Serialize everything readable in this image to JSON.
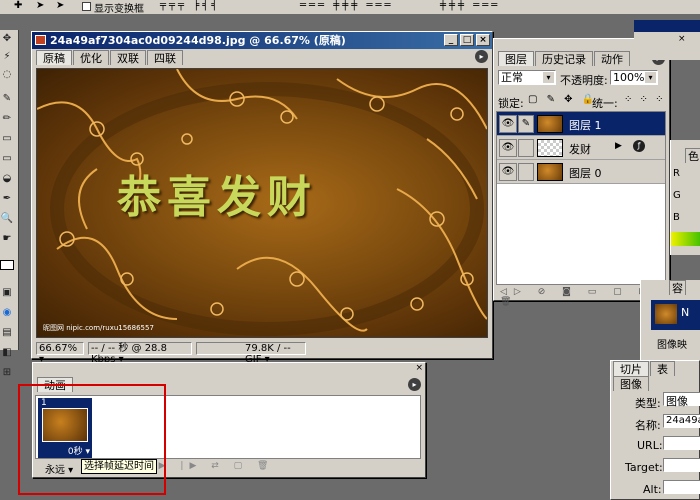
{
  "toolbar": {
    "show_transform": "显示变换框"
  },
  "doc": {
    "title": "24a49af7304ac0d09244d98.jpg @ 66.67% (原稿)",
    "tabs": [
      "原稿",
      "优化",
      "双联",
      "四联"
    ],
    "image_text": "恭喜发财",
    "watermark": "昵图网 nipic.com/ruxu15686557",
    "status_zoom": "66.67%",
    "status_time": "-- / -- 秒 @ 28.8 Kbps",
    "status_size": "79.8K / -- GIF"
  },
  "layers_panel": {
    "tabs": [
      "图层",
      "历史记录",
      "动作"
    ],
    "blend_mode": "正常",
    "opacity_label": "不透明度:",
    "opacity_value": "100%",
    "lock_label": "锁定:",
    "unify_label": "统一:",
    "layers": [
      {
        "name": "图层 1"
      },
      {
        "name": "发财"
      },
      {
        "name": "图层 0"
      }
    ]
  },
  "animation_panel": {
    "tab": "动画",
    "frame_number": "1",
    "frame_delay": "0秒",
    "loop": "永远",
    "tooltip": "选择帧延迟时间"
  },
  "right_panels": {
    "color_tab": "色",
    "content_tab": "容",
    "image_label": "图像映",
    "n_label": "N",
    "slice_tabs": [
      "切片",
      "表",
      "图像"
    ],
    "type_label": "类型:",
    "type_value": "图像",
    "name_label": "名称:",
    "name_value": "24a49af",
    "url_label": "URL:",
    "target_label": "Target:",
    "alt_label": "Alt:"
  },
  "colors": {
    "accent": "#0a246a",
    "highlight_box": "#d40000",
    "text_gold": "#c8d85a"
  }
}
